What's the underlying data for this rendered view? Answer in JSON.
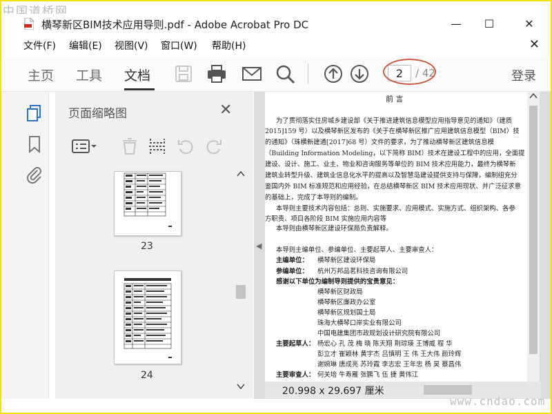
{
  "watermark_top": "中国道桥网",
  "watermark_bottom": "www.cndao.com",
  "window": {
    "title": "横琴新区BIM技术应用导则.pdf - Adobe Acrobat Pro DC",
    "minimize": "—",
    "maximize": "☐",
    "close": "✕"
  },
  "menu": {
    "items": [
      "文件(F)",
      "编辑(E)",
      "视图(V)",
      "窗口(W)",
      "帮助(H)"
    ],
    "close_doc": "✕"
  },
  "toolbar": {
    "tabs": [
      "主页",
      "工具",
      "文档"
    ],
    "active_tab": "文档",
    "page_current": "2",
    "page_total": "/ 42",
    "login": "登录"
  },
  "thumbnail_pane": {
    "title": "页面缩略图",
    "close": "✕",
    "pages": [
      {
        "label": "23"
      },
      {
        "label": "24"
      }
    ]
  },
  "document": {
    "heading": "前  言",
    "paragraphs": [
      "为了贯彻落实住房城乡建设部《关于推进建筑信息模型应用指导意见的通知》（建质",
      "2015]159 号）以及横琴新区发布的《关于在横琴新区推广应用建筑信息模型（BIM）技",
      "的通知》（珠横新建通[2017]68 号）文件的要求，为了推动横琴新区建筑信息模",
      "（Building Information Modeling，以下简称 BIM）技术在建设工程中的应用，全面提",
      "建设、设计、施工、业主、物业和咨询服务等单位的 BIM 技术应用能力，最终为横琴新",
      "建筑业转型升级、建筑业信息化水平的提高以及智慧岛建设提供支持与保障，编制组充分",
      "鉴国内外 BIM 标准规范和应用经验，在总结横琴新区 BIM 技术应用现状、并广泛征求意",
      "的基础上，完成了本导则的编制。",
      "本导则主要技术内容包括：总则、实施要求、应用模式、实施方式、组织架构、各参",
      "方职责、项目各阶段 BIM 实施应用内容等",
      "本导则由横琴新区建设环保局负责解释。"
    ],
    "units_intro": "本导则主编单位、参编单位、主要起草人、主要审查人：",
    "chief_unit_label": "主编单位：",
    "chief_unit": "横琴新区建设环保局",
    "co_unit_label": "参编单位：",
    "co_unit": "杭州万邦品茗科技咨询有限公司",
    "thanks": "感谢以下单位为编制导则提供的宝贵意见：",
    "thanks_units": [
      "横琴新区财政局",
      "横琴新区廉政办公室",
      "横琴新区规划国土局",
      "珠海大横琴口岸实业有限公司",
      "中国电建集团市政规划设计研究院有限公司"
    ],
    "drafters_label": "主要起草人：",
    "drafters_rows": [
      "杨宏心   孔   茂   梅   晓   陈天翔   荆琮瑛   王博威   程   华",
      "彭立才   崔颖林   黄宇杰   吕慎明   王   伟   王大伟   颜玲辉",
      "谢婉琳   唐成亮   苏玲霞   李志宏   王年忠   杨   昊   蔡昌伟"
    ],
    "reviewers_label": "主要审查人：",
    "reviewers": "何关培   牛寿雁   张鹏飞   伍   捷   黄伟江"
  },
  "status": {
    "page_size": "20.998 x 29.697 厘米"
  }
}
